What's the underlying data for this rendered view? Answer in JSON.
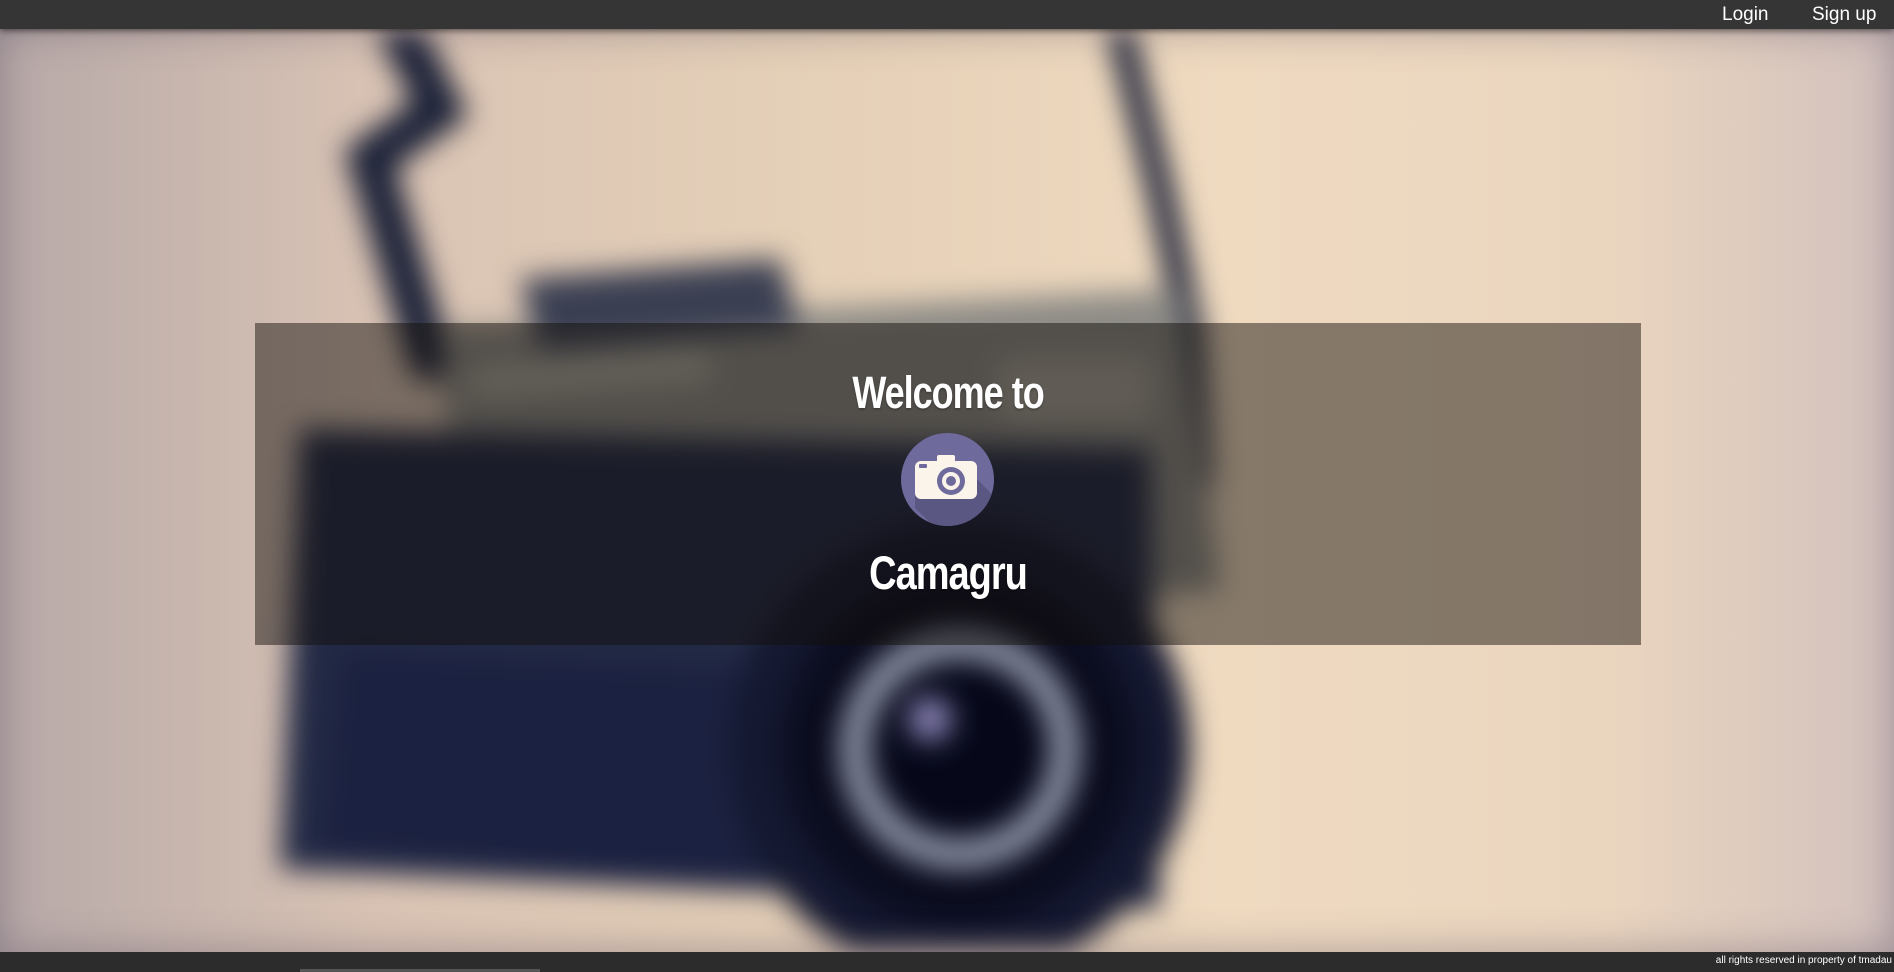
{
  "nav": {
    "login_label": "Login",
    "signup_label": "Sign up"
  },
  "hero": {
    "welcome_text": "Welcome to",
    "brand_name": "Camagru",
    "logo_icon": "camera-icon",
    "logo_color": "#6f6a9c"
  },
  "footer": {
    "copyright_text": "all rights reserved in property of tmadau"
  },
  "colors": {
    "topbar": "#353535",
    "footer": "#2c2c2c",
    "overlay": "rgba(18,14,10,0.48)"
  }
}
